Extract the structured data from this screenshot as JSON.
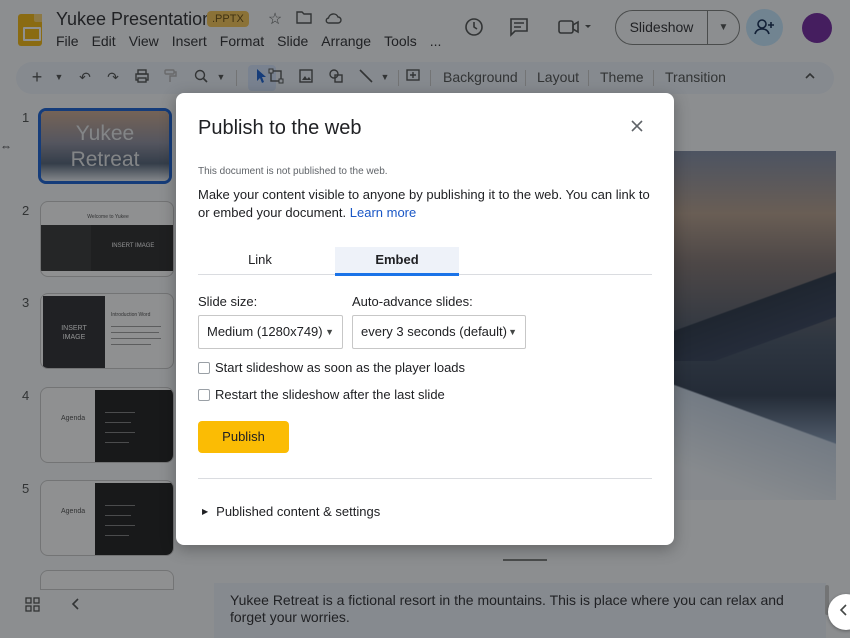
{
  "header": {
    "doc_title": "Yukee Presentation",
    "file_badge": ".PPTX",
    "menu": [
      "File",
      "Edit",
      "View",
      "Insert",
      "Format",
      "Slide",
      "Arrange",
      "Tools",
      "..."
    ],
    "slideshow_label": "Slideshow"
  },
  "toolbar": {
    "background_label": "Background",
    "layout_label": "Layout",
    "theme_label": "Theme",
    "transition_label": "Transition"
  },
  "filmstrip": {
    "slide_numbers": [
      "1",
      "2",
      "3",
      "4",
      "5"
    ],
    "slide1_title": "Yukee Retreat",
    "slide2_heading": "Welcome to Yukee",
    "slide2_image_placeholder": "INSERT IMAGE",
    "slide3_image_placeholder": "INSERT IMAGE",
    "slide3_heading": "Introduction Word",
    "slide4_heading": "Agenda",
    "slide5_heading": "Agenda"
  },
  "notes": {
    "text": "Yukee Retreat is a fictional resort in the mountains. This is place where you can relax and forget your worries."
  },
  "dialog": {
    "title": "Publish to the web",
    "status": "This document is not published to the web.",
    "description": "Make your content visible to anyone by publishing it to the web. You can link to or embed your document.",
    "learn_more": "Learn more",
    "tabs": {
      "link": "Link",
      "embed": "Embed"
    },
    "slide_size_label": "Slide size:",
    "slide_size_value": "Medium (1280x749)",
    "auto_advance_label": "Auto-advance slides:",
    "auto_advance_value": "every 3 seconds (default)",
    "checkbox_start": "Start slideshow as soon as the player loads",
    "checkbox_restart": "Restart the slideshow after the last slide",
    "publish_label": "Publish",
    "published_settings": "Published content & settings"
  },
  "colors": {
    "accent_blue": "#0b57d0",
    "publish_yellow": "#fbbc04",
    "avatar_purple": "#6a1b9a",
    "link_blue": "#1a57c6"
  }
}
